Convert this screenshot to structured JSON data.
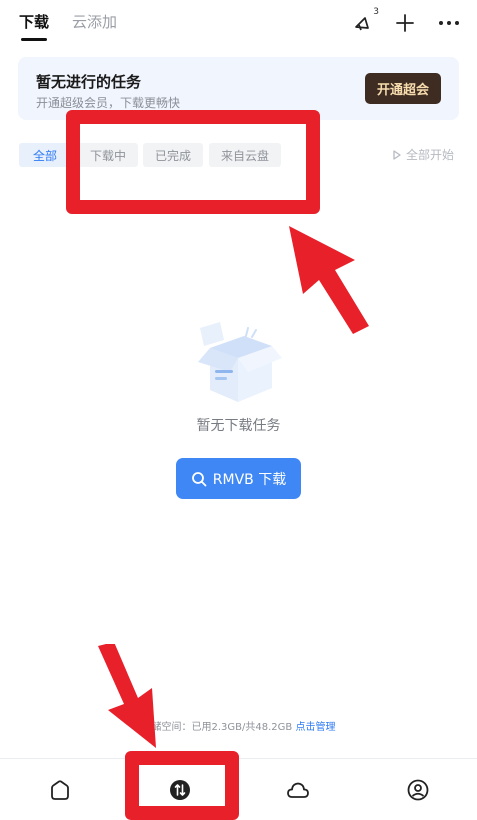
{
  "tabs": {
    "active": "下载",
    "inactive": "云添加"
  },
  "top_actions": {
    "notify_badge": "3"
  },
  "promo": {
    "title": "暂无进行的任务",
    "subtitle": "开通超级会员，下载更畅快",
    "button": "开通超会"
  },
  "filters": [
    "全部",
    "下载中",
    "已完成",
    "来自云盘"
  ],
  "start_all": "全部开始",
  "empty": {
    "message": "暂无下载任务",
    "button": "RMVB 下载"
  },
  "storage": {
    "text": "存储空间：已用2.3GB/共48.2GB",
    "link": "点击管理"
  },
  "colors": {
    "accent": "#3f87f5",
    "vip_button_bg": "#3e2b21",
    "vip_button_text": "#f7dcae",
    "annotation_red": "#e8202a"
  },
  "icons": {
    "top": [
      "broadcast-icon",
      "plus-icon",
      "more-icon"
    ],
    "nav": [
      "home-icon",
      "transfer-icon",
      "cloud-icon",
      "profile-icon"
    ]
  }
}
